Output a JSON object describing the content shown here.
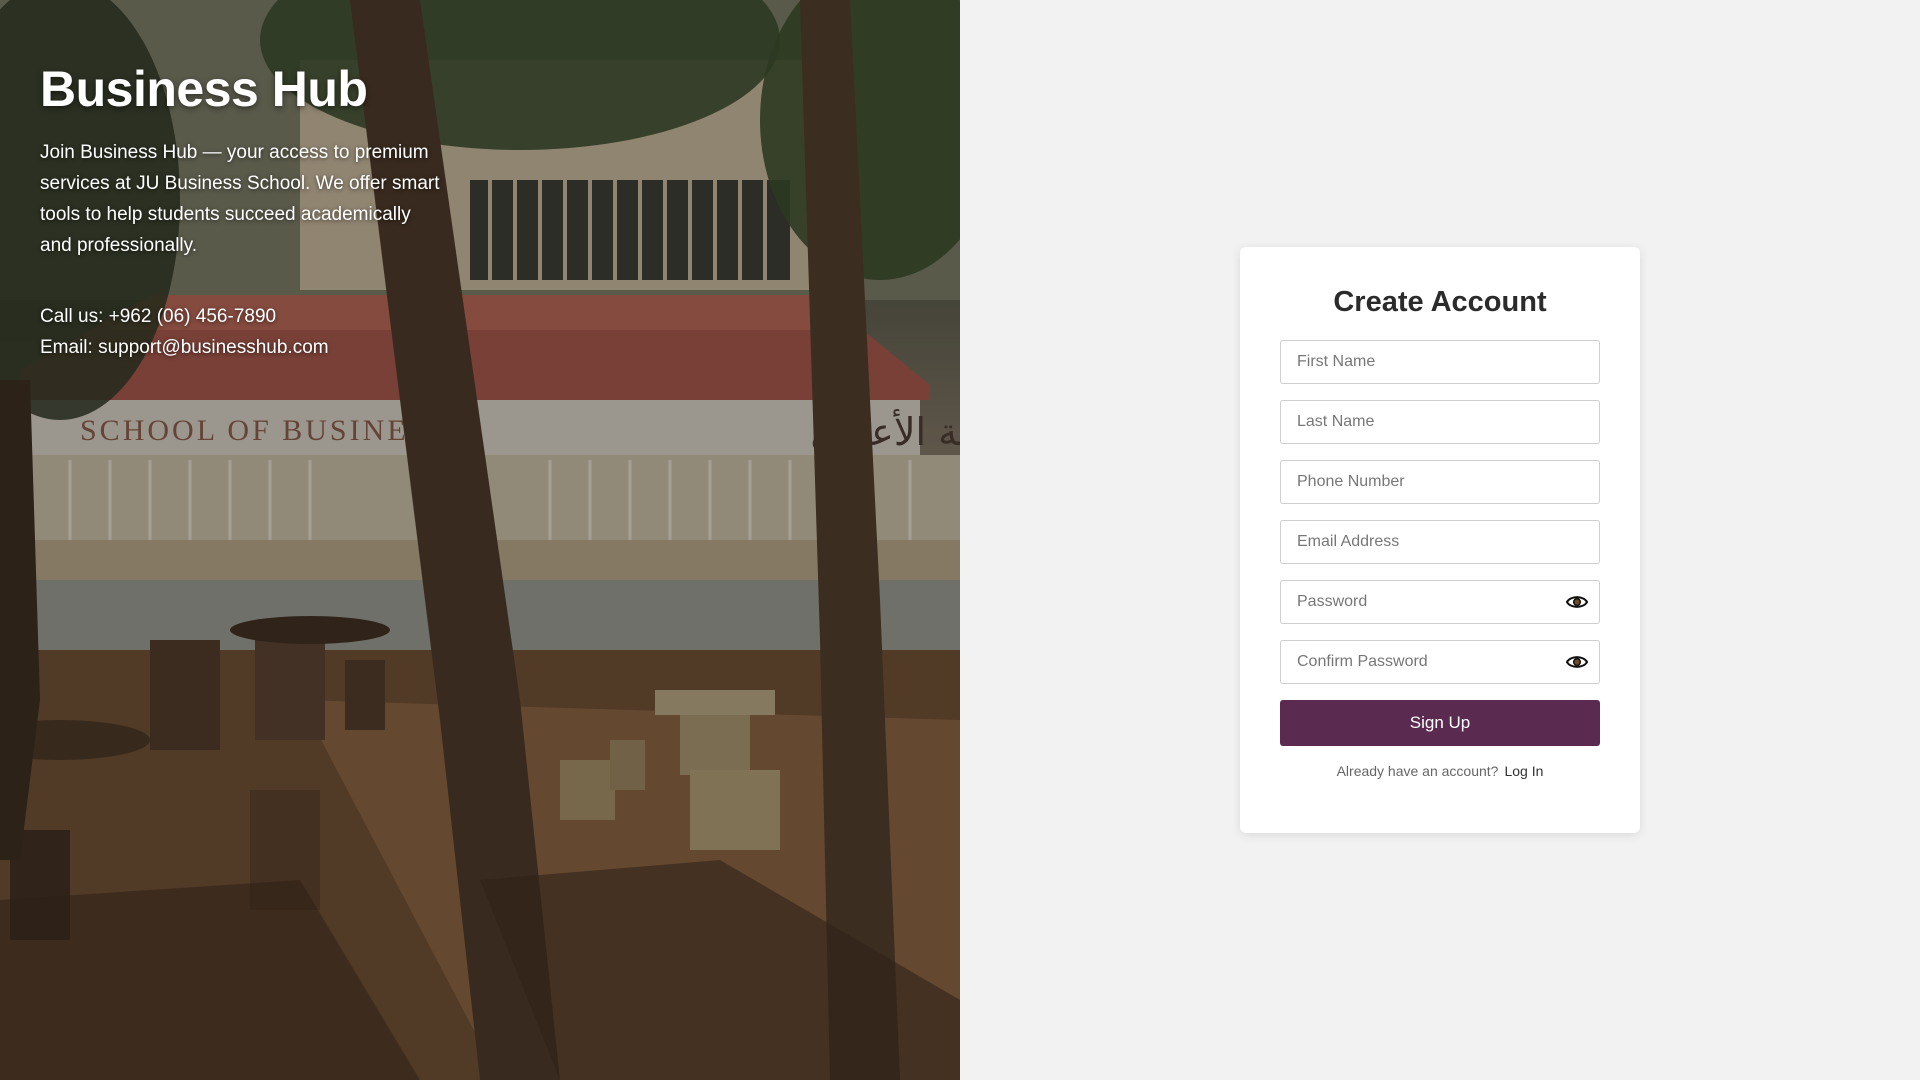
{
  "hero": {
    "title": "Business Hub",
    "description": "Join Business Hub — your access to premium services at JU Business School. We offer smart tools to help students succeed academically and professionally.",
    "phone": "Call us: +962 (06) 456-7890",
    "email": "Email: support@businesshub.com",
    "sign_en": "SCHOOL OF BUSINESS",
    "sign_ar": "كلية الأعمال"
  },
  "form": {
    "title": "Create Account",
    "first_name_placeholder": "First Name",
    "last_name_placeholder": "Last Name",
    "phone_placeholder": "Phone Number",
    "email_placeholder": "Email Address",
    "password_placeholder": "Password",
    "confirm_password_placeholder": "Confirm Password",
    "submit_label": "Sign Up",
    "login_prompt": "Already have an account?",
    "login_link": "Log In"
  },
  "colors": {
    "primary": "#5a2a50",
    "panel_bg": "#f2f2f2",
    "card_bg": "#ffffff"
  },
  "icons": {
    "password_toggle": "eye-icon",
    "confirm_password_toggle": "eye-icon"
  }
}
